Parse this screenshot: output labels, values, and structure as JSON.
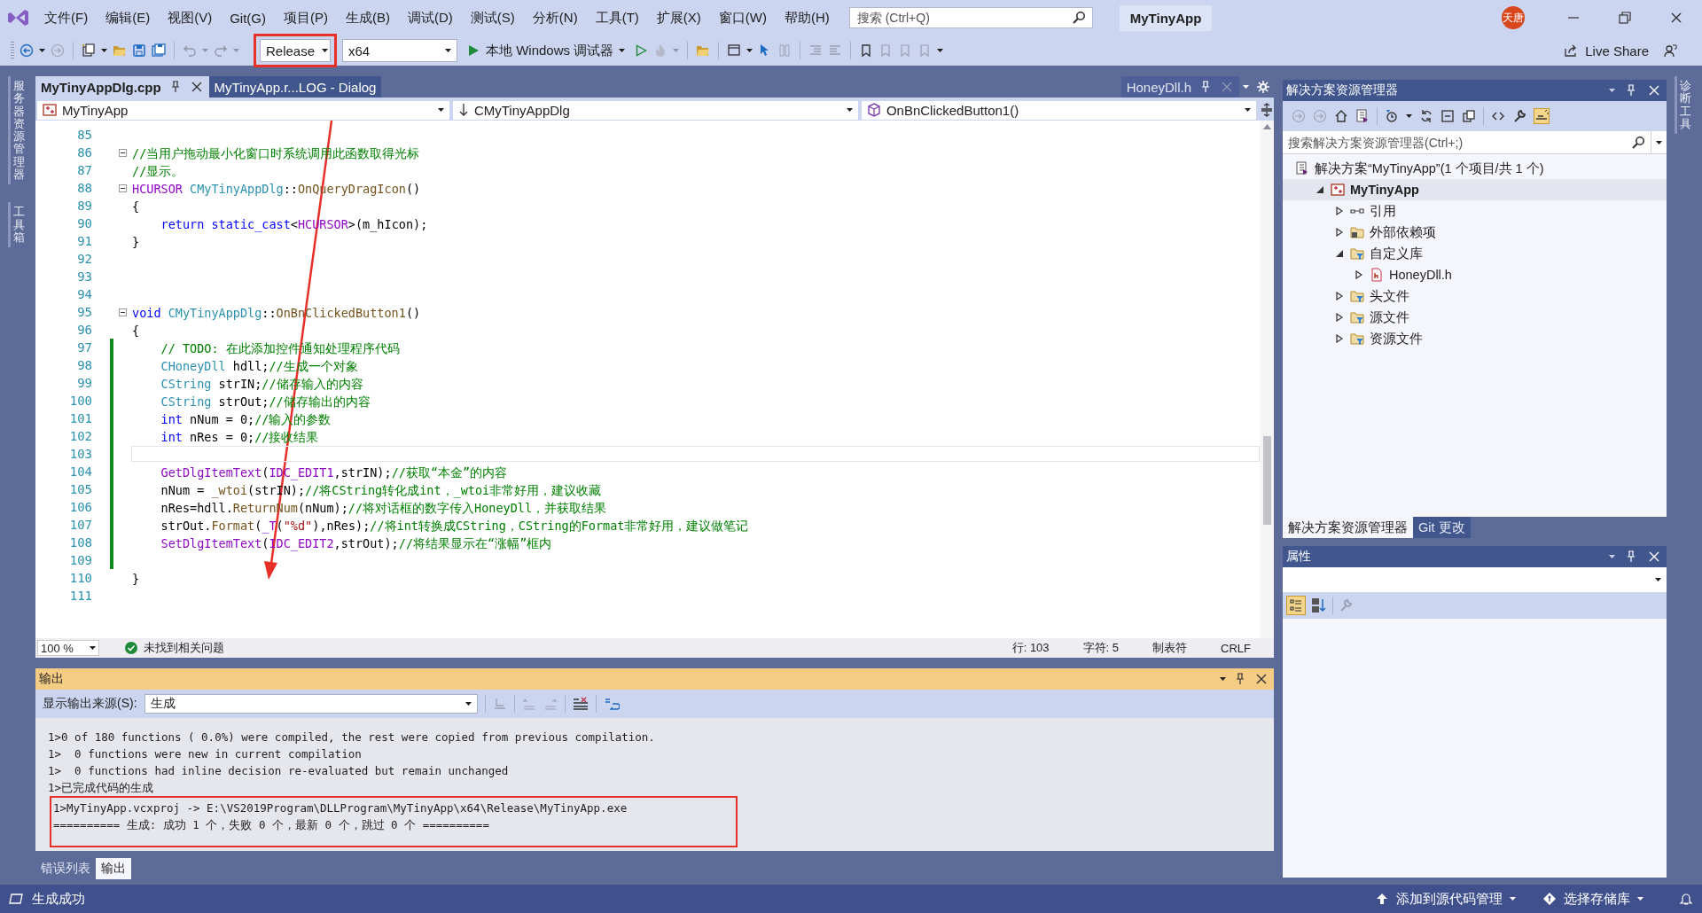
{
  "title_bar": {
    "menu": [
      "文件(F)",
      "编辑(E)",
      "视图(V)",
      "Git(G)",
      "项目(P)",
      "生成(B)",
      "调试(D)",
      "测试(S)",
      "分析(N)",
      "工具(T)",
      "扩展(X)",
      "窗口(W)",
      "帮助(H)"
    ],
    "search": {
      "placeholder": "搜索 (Ctrl+Q)"
    },
    "solution_name": "MyTinyApp",
    "avatar": "天唐"
  },
  "toolbar": {
    "configuration": "Release",
    "platform": "x64",
    "debug_target": "本地 Windows 调试器",
    "live_share": "Live Share"
  },
  "left_side_tabs": [
    "服务器资源管理器",
    "工具箱"
  ],
  "right_side_tabs": [
    "诊断工具"
  ],
  "document_tabs": [
    {
      "label": "MyTinyAppDlg.cpp",
      "selected": true,
      "kind": "document",
      "closable": true
    },
    {
      "label": "MyTinyApp.r...LOG - Dialog",
      "selected": false,
      "kind": "document",
      "closable": false
    },
    {
      "label": "HoneyDll.h",
      "selected": false,
      "kind": "preview",
      "closable": true
    }
  ],
  "nav_bar": {
    "project": "MyTinyApp",
    "class": "CMyTinyAppDlg",
    "member": "OnBnClickedButton1()"
  },
  "code": {
    "lines": [
      {
        "n": "85",
        "fold": false,
        "changed": false,
        "current": false
      },
      {
        "n": "86",
        "fold": true,
        "changed": false,
        "current": false,
        "indent": false,
        "tokens": [
          {
            "kind": "comment",
            "text": "//当用户拖动最小化窗口时系统调用此函数取得光标"
          }
        ]
      },
      {
        "n": "87",
        "fold": false,
        "changed": false,
        "current": false,
        "indent": false,
        "tokens": [
          {
            "kind": "comment",
            "text": "//显示。"
          }
        ]
      },
      {
        "n": "88",
        "fold": true,
        "changed": false,
        "current": false,
        "indent": false,
        "tokens": [
          {
            "kind": "macro",
            "text": "HCURSOR "
          },
          {
            "kind": "type",
            "text": "CMyTinyAppDlg"
          },
          {
            "kind": "plain",
            "text": "::"
          },
          {
            "kind": "function",
            "text": "OnQueryDragIcon"
          },
          {
            "kind": "plain",
            "text": "()"
          }
        ]
      },
      {
        "n": "89",
        "fold": false,
        "changed": false,
        "current": false,
        "indent": false,
        "tokens": [
          {
            "kind": "plain",
            "text": "{"
          }
        ]
      },
      {
        "n": "90",
        "fold": false,
        "changed": false,
        "current": false,
        "indent": true,
        "tokens": [
          {
            "kind": "keyword",
            "text": "return static_cast"
          },
          {
            "kind": "plain",
            "text": "<"
          },
          {
            "kind": "macro",
            "text": "HCURSOR"
          },
          {
            "kind": "plain",
            "text": ">(m_hIcon);"
          }
        ]
      },
      {
        "n": "91",
        "fold": false,
        "changed": false,
        "current": false,
        "indent": false,
        "tokens": [
          {
            "kind": "plain",
            "text": "}"
          }
        ]
      },
      {
        "n": "92",
        "fold": false,
        "changed": false,
        "current": false
      },
      {
        "n": "93",
        "fold": false,
        "changed": false,
        "current": false
      },
      {
        "n": "94",
        "fold": false,
        "changed": false,
        "current": false
      },
      {
        "n": "95",
        "fold": true,
        "changed": false,
        "current": false,
        "indent": false,
        "tokens": [
          {
            "kind": "keyword",
            "text": "void "
          },
          {
            "kind": "type",
            "text": "CMyTinyAppDlg"
          },
          {
            "kind": "plain",
            "text": "::"
          },
          {
            "kind": "function",
            "text": "OnBnClickedButton1"
          },
          {
            "kind": "plain",
            "text": "()"
          }
        ]
      },
      {
        "n": "96",
        "fold": false,
        "changed": false,
        "current": false,
        "indent": false,
        "tokens": [
          {
            "kind": "plain",
            "text": "{"
          }
        ]
      },
      {
        "n": "97",
        "fold": false,
        "changed": true,
        "current": false,
        "indent": true,
        "tokens": [
          {
            "kind": "comment",
            "text": "// TODO: 在此添加控件通知处理程序代码"
          }
        ]
      },
      {
        "n": "98",
        "fold": false,
        "changed": true,
        "current": false,
        "indent": true,
        "tokens": [
          {
            "kind": "type",
            "text": "CHoneyDll"
          },
          {
            "kind": "plain",
            "text": " hdll;"
          },
          {
            "kind": "comment",
            "text": "//生成一个对象"
          }
        ]
      },
      {
        "n": "99",
        "fold": false,
        "changed": true,
        "current": false,
        "indent": true,
        "tokens": [
          {
            "kind": "type",
            "text": "CString"
          },
          {
            "kind": "plain",
            "text": " strIN;"
          },
          {
            "kind": "comment",
            "text": "//储存输入的内容"
          }
        ]
      },
      {
        "n": "100",
        "fold": false,
        "changed": true,
        "current": false,
        "indent": true,
        "tokens": [
          {
            "kind": "type",
            "text": "CString"
          },
          {
            "kind": "plain",
            "text": " strOut;"
          },
          {
            "kind": "comment",
            "text": "//储存输出的内容"
          }
        ]
      },
      {
        "n": "101",
        "fold": false,
        "changed": true,
        "current": false,
        "indent": true,
        "tokens": [
          {
            "kind": "keyword",
            "text": "int"
          },
          {
            "kind": "plain",
            "text": " nNum = 0;"
          },
          {
            "kind": "comment",
            "text": "//输入的参数"
          }
        ]
      },
      {
        "n": "102",
        "fold": false,
        "changed": true,
        "current": false,
        "indent": true,
        "tokens": [
          {
            "kind": "keyword",
            "text": "int"
          },
          {
            "kind": "plain",
            "text": " nRes = 0;"
          },
          {
            "kind": "comment",
            "text": "//接收结果"
          }
        ]
      },
      {
        "n": "103",
        "fold": false,
        "changed": true,
        "current": true
      },
      {
        "n": "104",
        "fold": false,
        "changed": true,
        "current": false,
        "indent": true,
        "tokens": [
          {
            "kind": "macro",
            "text": "GetDlgItemText"
          },
          {
            "kind": "plain",
            "text": "("
          },
          {
            "kind": "macro",
            "text": "IDC_EDIT1"
          },
          {
            "kind": "plain",
            "text": ",strIN);"
          },
          {
            "kind": "comment",
            "text": "//获取“本金”的内容"
          }
        ]
      },
      {
        "n": "105",
        "fold": false,
        "changed": true,
        "current": false,
        "indent": true,
        "tokens": [
          {
            "kind": "plain",
            "text": "nNum = "
          },
          {
            "kind": "function",
            "text": "_wtoi"
          },
          {
            "kind": "plain",
            "text": "(strIN);"
          },
          {
            "kind": "comment",
            "text": "//将CString转化成int，_wtoi非常好用，建议收藏"
          }
        ]
      },
      {
        "n": "106",
        "fold": false,
        "changed": true,
        "current": false,
        "indent": true,
        "tokens": [
          {
            "kind": "plain",
            "text": "nRes=hdll."
          },
          {
            "kind": "function",
            "text": "ReturnNum"
          },
          {
            "kind": "plain",
            "text": "(nNum);"
          },
          {
            "kind": "comment",
            "text": "//将对话框的数字传入HoneyDll，并获取结果"
          }
        ]
      },
      {
        "n": "107",
        "fold": false,
        "changed": true,
        "current": false,
        "indent": true,
        "tokens": [
          {
            "kind": "plain",
            "text": "strOut."
          },
          {
            "kind": "function",
            "text": "Format"
          },
          {
            "kind": "plain",
            "text": "("
          },
          {
            "kind": "macro",
            "text": "_T"
          },
          {
            "kind": "plain",
            "text": "("
          },
          {
            "kind": "string",
            "text": "\"%d\""
          },
          {
            "kind": "plain",
            "text": "),nRes);"
          },
          {
            "kind": "comment",
            "text": "//将int转换成CString，CString的Format非常好用，建议做笔记"
          }
        ]
      },
      {
        "n": "108",
        "fold": false,
        "changed": true,
        "current": false,
        "indent": true,
        "tokens": [
          {
            "kind": "macro",
            "text": "SetDlgItemText"
          },
          {
            "kind": "plain",
            "text": "("
          },
          {
            "kind": "macro",
            "text": "IDC_EDIT2"
          },
          {
            "kind": "plain",
            "text": ",strOut);"
          },
          {
            "kind": "comment",
            "text": "//将结果显示在“涨幅”框内"
          }
        ]
      },
      {
        "n": "109",
        "fold": false,
        "changed": true,
        "current": false
      },
      {
        "n": "110",
        "fold": false,
        "changed": false,
        "current": false,
        "indent": false,
        "tokens": [
          {
            "kind": "plain",
            "text": "}"
          }
        ]
      },
      {
        "n": "111",
        "fold": false,
        "changed": false,
        "current": false
      }
    ]
  },
  "editor_status": {
    "zoom": "100 %",
    "issues": "未找到相关问题",
    "line": "行: 103",
    "char": "字符: 5",
    "indent": "制表符",
    "eol": "CRLF"
  },
  "output": {
    "title": "输出",
    "source_label": "显示输出来源(S):",
    "source": "生成",
    "lines": [
      "1>0 of 180 functions ( 0.0%) were compiled, the rest were copied from previous compilation.",
      "1>  0 functions were new in current compilation",
      "1>  0 functions had inline decision re-evaluated but remain unchanged",
      "1>已完成代码的生成",
      "1>MyTinyApp.vcxproj -> E:\\VS2019Program\\DLLProgram\\MyTinyApp\\x64\\Release\\MyTinyApp.exe",
      "========== 生成: 成功 1 个，失败 0 个，最新 0 个，跳过 0 个 =========="
    ]
  },
  "bottom_tabs": [
    {
      "label": "错误列表",
      "selected": false
    },
    {
      "label": "输出",
      "selected": true
    }
  ],
  "solution_explorer": {
    "title": "解决方案资源管理器",
    "search": {
      "placeholder": "搜索解决方案资源管理器(Ctrl+;)"
    },
    "tree": [
      {
        "label": "解决方案“MyTinyApp”(1 个项目/共 1 个)",
        "kind": "solution",
        "selected": false,
        "children": [
          {
            "label": "MyTinyApp",
            "kind": "project",
            "selected": true,
            "expanded": true,
            "children": [
              {
                "label": "引用",
                "kind": "reference",
                "selected": false,
                "expanded": false
              },
              {
                "label": "外部依赖项",
                "kind": "external",
                "selected": false,
                "expanded": false
              },
              {
                "label": "自定义库",
                "kind": "filter",
                "selected": false,
                "expanded": true,
                "children": [
                  {
                    "label": "HoneyDll.h",
                    "kind": "header",
                    "selected": false,
                    "expanded": false
                  }
                ]
              },
              {
                "label": "头文件",
                "kind": "filter",
                "selected": false,
                "expanded": false
              },
              {
                "label": "源文件",
                "kind": "filter",
                "selected": false,
                "expanded": false
              },
              {
                "label": "资源文件",
                "kind": "filter",
                "selected": false,
                "expanded": false
              }
            ]
          }
        ]
      }
    ]
  },
  "panel_tabs": [
    {
      "label": "解决方案资源管理器",
      "selected": true
    },
    {
      "label": "Git 更改",
      "selected": false
    }
  ],
  "properties": {
    "title": "属性"
  },
  "status_bar": {
    "message": "生成成功",
    "source_control": "添加到源代码管理",
    "repository": "选择存储库"
  }
}
